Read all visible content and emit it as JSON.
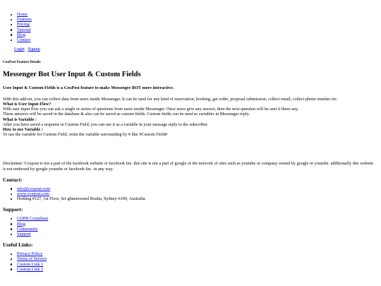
{
  "nav": {
    "items": [
      "Home",
      "Features",
      "Pricing",
      "Tutorial",
      "Blog",
      "Contact"
    ]
  },
  "auth": {
    "login": "Login",
    "signup": "Signup"
  },
  "breadcrumb": "CoxPost Feature Details",
  "title": "Messenger Bot User Input & Custom Fields",
  "lead": "User Input & Custom Fields is a CoxPost feature to make Messenger BOT more interactive.",
  "content": {
    "intro": "With this add-on, you can collect data from users inside Messenger. It can be used for any kind of reservation, booking, get order, proposal submission, collect email, collect phone number etc.",
    "q1": "What is User Input Flow?",
    "a1_line1": "With user input flow you can ask a single or series of questions from users inside Messenger. Once users give any answer, then the next question will be sent if there any.",
    "a1_line2": "These answers will be saved in the database & also can be saved as custom fields. Custom fields can be used as variables in Messenger reply.",
    "q2": "What is Variable :",
    "a2": "After you have saved a response in Custom Field, you can use it as a variable in your message reply to the subscriber.",
    "q3": "How to use Variable :",
    "a3": "To use the variable for Custom Field, write the variable surrounding by # like #Custom Field#"
  },
  "disclaimer": "Disclaimer: Coxpost is not a part of the facebook website or facebook Inc. this site is not a part of google or the network of sites such as youtube or company owned by google or youtube. additionally this website is not endorsed by google youtube or facebook Inc. in any way.",
  "contact": {
    "heading": "Contact:",
    "email": "info@coxpost.com",
    "website": "www.coxpost.com",
    "address": "Holding #127, 1st Floor, Sri-ghatawested Boalia, Sydney-6100, Australia."
  },
  "support": {
    "heading": "Support:",
    "items": [
      "GDPR Compliant",
      "Blog",
      "Community",
      "Support"
    ]
  },
  "useful": {
    "heading": "Useful Links:",
    "items": [
      "Privacy Policy",
      "Terms of Service",
      "Custom Link 1",
      "Custom Link 2"
    ]
  }
}
